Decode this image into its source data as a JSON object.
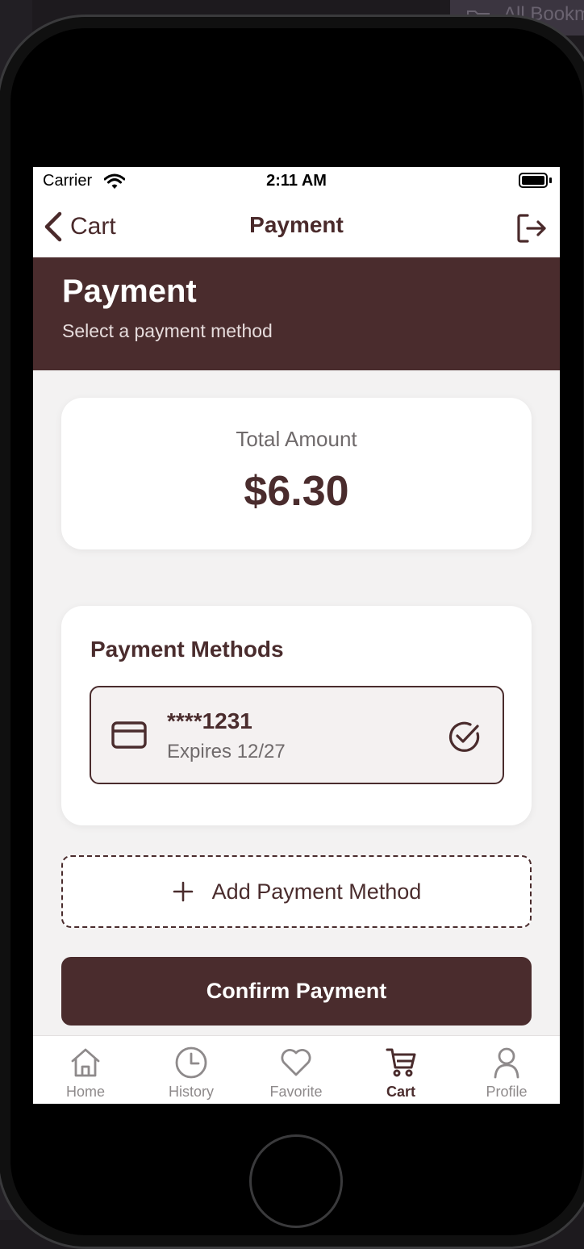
{
  "background": {
    "tab_label": "All Bookm"
  },
  "status_bar": {
    "carrier": "Carrier",
    "time": "2:11 AM"
  },
  "nav": {
    "back_label": "Cart",
    "title": "Payment"
  },
  "header": {
    "title": "Payment",
    "subtitle": "Select a payment method"
  },
  "total": {
    "label": "Total Amount",
    "value": "$6.30"
  },
  "methods": {
    "title": "Payment Methods",
    "items": [
      {
        "number": "****1231",
        "expiry": "Expires 12/27",
        "selected": true
      }
    ]
  },
  "actions": {
    "add_label": "Add Payment Method",
    "confirm_label": "Confirm Payment"
  },
  "tabs": [
    {
      "label": "Home",
      "icon": "home-icon"
    },
    {
      "label": "History",
      "icon": "clock-icon"
    },
    {
      "label": "Favorite",
      "icon": "heart-icon"
    },
    {
      "label": "Cart",
      "icon": "cart-icon",
      "active": true
    },
    {
      "label": "Profile",
      "icon": "person-icon"
    }
  ],
  "colors": {
    "brand": "#4a2c2d",
    "background": "#f3f2f2",
    "inactive_tab": "#8e8a8b"
  }
}
